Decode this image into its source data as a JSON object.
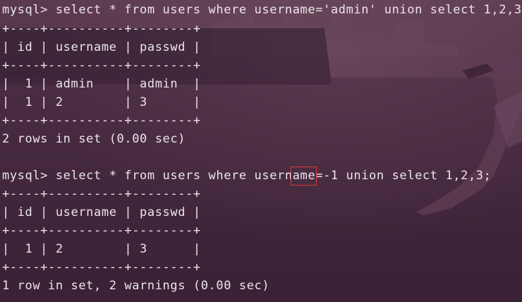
{
  "terminal": {
    "block1": {
      "prompt": "mysql> select * from users where username='admin' union select 1,2,3;",
      "border_top": "+----+----------+--------+",
      "header": "| id | username | passwd |",
      "border_mid": "+----+----------+--------+",
      "row1": "|  1 | admin    | admin  |",
      "row2": "|  1 | 2        | 3      |",
      "border_bottom": "+----+----------+--------+",
      "status": "2 rows in set (0.00 sec)"
    },
    "block2": {
      "prompt_before": "mysql> select * from users where username=",
      "highlight": "-1",
      "prompt_after": " union select 1,2,3;",
      "border_top": "+----+----------+--------+",
      "header": "| id | username | passwd |",
      "border_mid": "+----+----------+--------+",
      "row1": "|  1 | 2        | 3      |",
      "border_bottom": "+----+----------+--------+",
      "status": "1 row in set, 2 warnings (0.00 sec)"
    }
  },
  "colors": {
    "text": "#ece6ea",
    "highlight_box": "#e0393a",
    "background": "#3f2436"
  }
}
